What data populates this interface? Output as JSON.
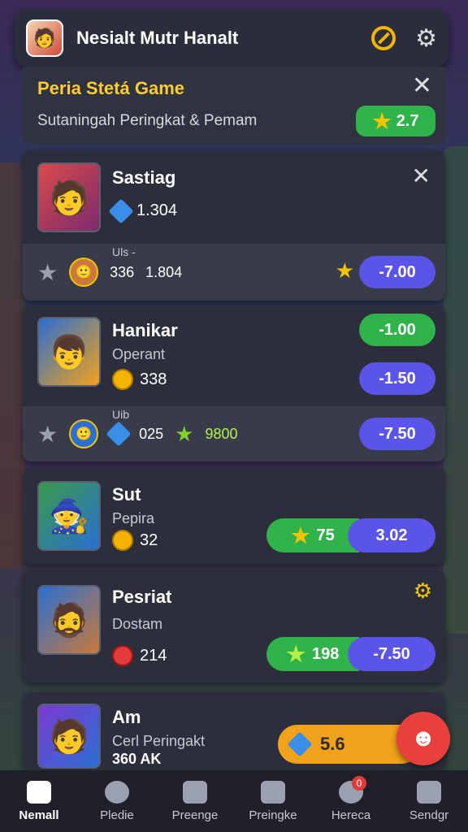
{
  "header": {
    "title": "Nesialt Mutr Hanalt"
  },
  "banner": {
    "title": "Peria Stetá Game",
    "subtitle": "Sutaningah Peringkat & Pemam",
    "pill_value": "2.7"
  },
  "cards": [
    {
      "name": "Sastiag",
      "stat": "1.304",
      "sub_label": "Uls -",
      "sub_val1": "336",
      "sub_val2": "1.804",
      "pill": "7.00"
    },
    {
      "name": "Hanikar",
      "role": "Operant",
      "stat": "338",
      "pill_green": "1.00",
      "pill_purple": "1.50",
      "sub_label": "Uib",
      "sub_val1": "025",
      "sub_val2": "9800",
      "sub_pill": "7.50"
    },
    {
      "name": "Sut",
      "role": "Pepira",
      "stat": "32",
      "combo_left": "75",
      "combo_right": "3.02"
    },
    {
      "name": "Pesriat",
      "role": "Dostam",
      "stat": "214",
      "combo_left": "198",
      "combo_right": "7.50"
    },
    {
      "name": "Am",
      "role": "Cerl Peringakt",
      "stat": "360 AK",
      "pill": "5.6"
    }
  ],
  "nav": [
    {
      "label": "Nemall"
    },
    {
      "label": "Pledie"
    },
    {
      "label": "Preenge"
    },
    {
      "label": "Preingke"
    },
    {
      "label": "Hereca",
      "badge": "0"
    },
    {
      "label": "Sendgr"
    }
  ]
}
